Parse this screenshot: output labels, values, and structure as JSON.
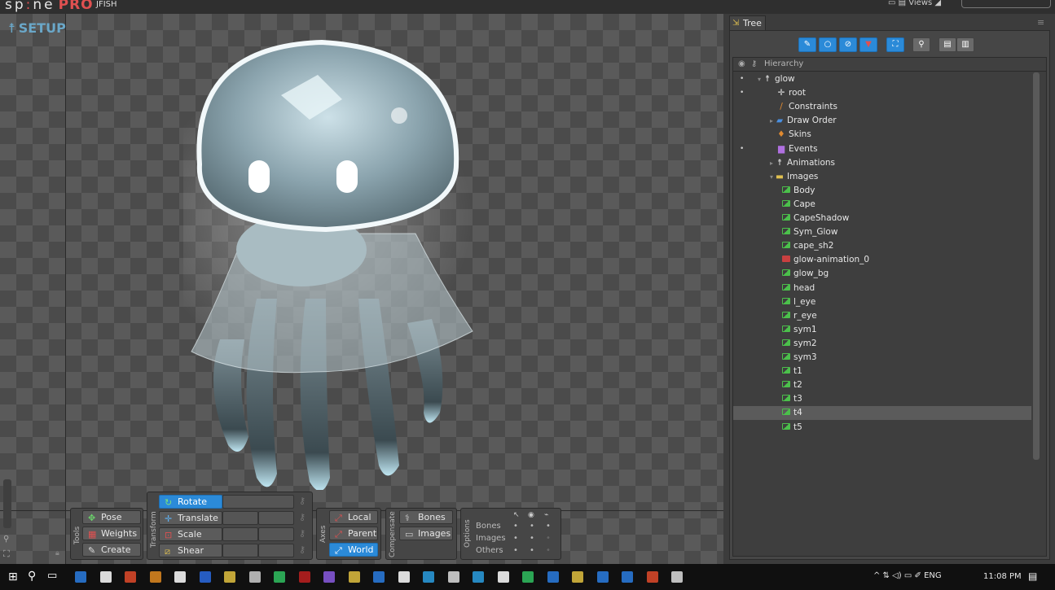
{
  "app": {
    "name_part1": "sp",
    "name_part2": "ne",
    "edition": "PRO",
    "project": "JFISH"
  },
  "topbar": {
    "views_label": "Views"
  },
  "viewport": {
    "mode_label": "SETUP"
  },
  "tools": {
    "group_label": "Tools",
    "items": [
      {
        "label": "Pose",
        "icon": "pose-icon"
      },
      {
        "label": "Weights",
        "icon": "weights-icon"
      },
      {
        "label": "Create",
        "icon": "create-icon"
      }
    ]
  },
  "transform": {
    "group_label": "Transform",
    "items": [
      {
        "label": "Rotate",
        "icon": "rotate-icon",
        "active": true
      },
      {
        "label": "Translate",
        "icon": "translate-icon"
      },
      {
        "label": "Scale",
        "icon": "scale-icon"
      },
      {
        "label": "Shear",
        "icon": "shear-icon"
      }
    ]
  },
  "axes": {
    "group_label": "Axes",
    "items": [
      {
        "label": "Local"
      },
      {
        "label": "Parent"
      },
      {
        "label": "World",
        "active": true
      }
    ]
  },
  "compensate": {
    "group_label": "Compensate",
    "items": [
      {
        "label": "Bones"
      },
      {
        "label": "Images"
      }
    ]
  },
  "options": {
    "group_label": "Options",
    "rows": [
      {
        "label": "Bones"
      },
      {
        "label": "Images"
      },
      {
        "label": "Others"
      }
    ]
  },
  "tree": {
    "tab_label": "Tree",
    "header_label": "Hierarchy",
    "rows": [
      {
        "label": "glow",
        "indent": 0,
        "icon": "skeleton-icon",
        "dot": true
      },
      {
        "label": "root",
        "indent": 1,
        "icon": "bone-root-icon",
        "dot": true
      },
      {
        "label": "Constraints",
        "indent": 1,
        "icon": "constraints-icon"
      },
      {
        "label": "Draw Order",
        "indent": 1,
        "icon": "draw-order-icon"
      },
      {
        "label": "Skins",
        "indent": 1,
        "icon": "skins-icon"
      },
      {
        "label": "Events",
        "indent": 1,
        "icon": "events-icon",
        "dot": true
      },
      {
        "label": "Animations",
        "indent": 1,
        "icon": "animations-icon"
      },
      {
        "label": "Images",
        "indent": 1,
        "icon": "images-folder-icon"
      },
      {
        "label": "Body",
        "indent": 2,
        "icon": "image-icon"
      },
      {
        "label": "Cape",
        "indent": 2,
        "icon": "image-icon"
      },
      {
        "label": "CapeShadow",
        "indent": 2,
        "icon": "image-icon"
      },
      {
        "label": "Sym_Glow",
        "indent": 2,
        "icon": "image-icon"
      },
      {
        "label": "cape_sh2",
        "indent": 2,
        "icon": "image-icon"
      },
      {
        "label": "glow-animation_0",
        "indent": 2,
        "icon": "image-missing-icon"
      },
      {
        "label": "glow_bg",
        "indent": 2,
        "icon": "image-icon"
      },
      {
        "label": "head",
        "indent": 2,
        "icon": "image-icon"
      },
      {
        "label": "l_eye",
        "indent": 2,
        "icon": "image-icon"
      },
      {
        "label": "r_eye",
        "indent": 2,
        "icon": "image-icon"
      },
      {
        "label": "sym1",
        "indent": 2,
        "icon": "image-icon"
      },
      {
        "label": "sym2",
        "indent": 2,
        "icon": "image-icon"
      },
      {
        "label": "sym3",
        "indent": 2,
        "icon": "image-icon"
      },
      {
        "label": "t1",
        "indent": 2,
        "icon": "image-icon"
      },
      {
        "label": "t2",
        "indent": 2,
        "icon": "image-icon"
      },
      {
        "label": "t3",
        "indent": 2,
        "icon": "image-icon"
      },
      {
        "label": "t4",
        "indent": 2,
        "icon": "image-icon",
        "selected": true
      },
      {
        "label": "t5",
        "indent": 2,
        "icon": "image-icon"
      }
    ]
  },
  "taskbar": {
    "language": "ENG",
    "time": "11:08 PM"
  },
  "colors": {
    "accent": "#2b8ad8",
    "logo_red": "#e05050"
  }
}
